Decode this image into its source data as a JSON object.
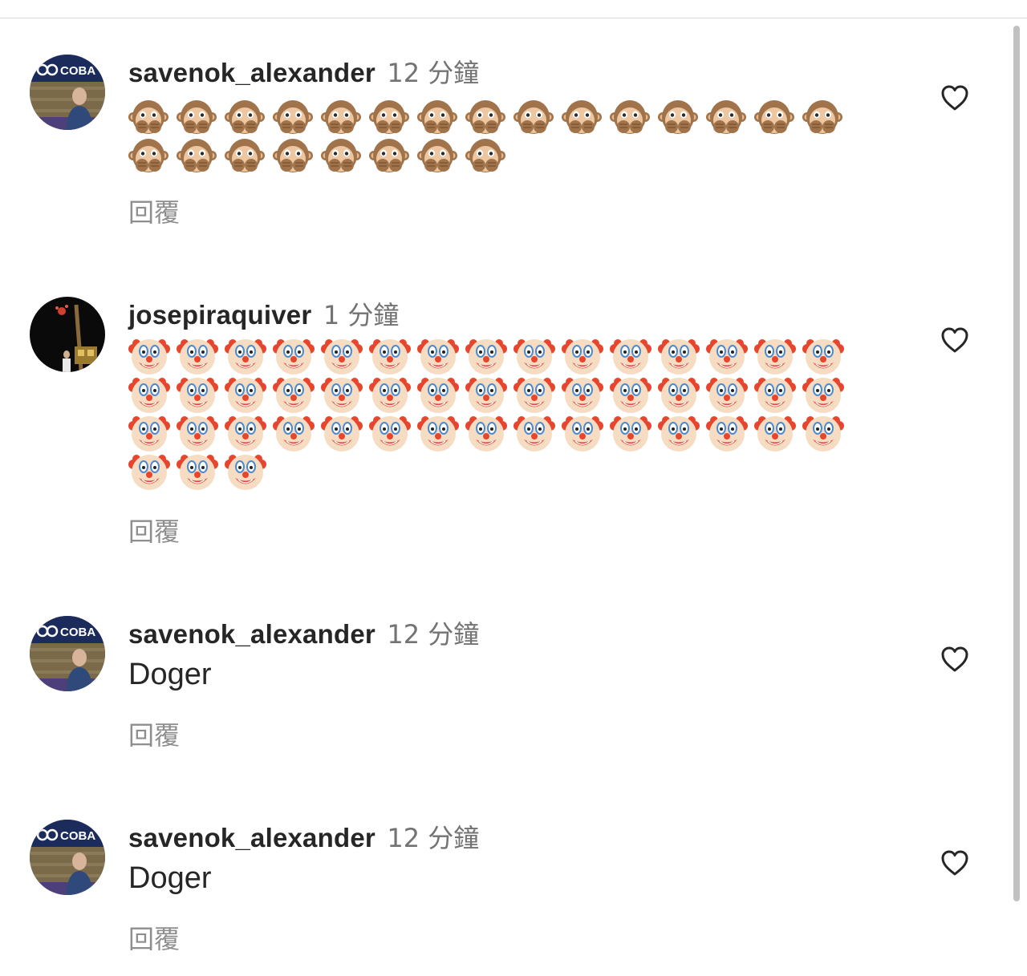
{
  "comments": [
    {
      "username": "savenok_alexander",
      "time": "12 分鐘",
      "text": "",
      "emoji": "🙊",
      "emoji_count": 23,
      "reply_label": "回覆",
      "avatar": "avatar-coba-sign"
    },
    {
      "username": "josepiraquiver",
      "time": "1 分鐘",
      "text": "",
      "emoji": "🤡",
      "emoji_count": 48,
      "reply_label": "回覆",
      "avatar": "avatar-night-fireworks"
    },
    {
      "username": "savenok_alexander",
      "time": "12 分鐘",
      "text": "Doger",
      "emoji": "",
      "emoji_count": 0,
      "reply_label": "回覆",
      "avatar": "avatar-coba-sign"
    },
    {
      "username": "savenok_alexander",
      "time": "12 分鐘",
      "text": "Doger",
      "emoji": "",
      "emoji_count": 0,
      "reply_label": "回覆",
      "avatar": "avatar-coba-sign"
    }
  ],
  "avatar_sign_text": "COBA",
  "icons": {
    "like": "heart-outline-icon",
    "monkey": "speak-no-evil-monkey-icon",
    "clown": "clown-face-icon"
  },
  "colors": {
    "text": "#262626",
    "secondary": "#737373",
    "reply": "#8e8e8e",
    "divider": "#dbdbdb",
    "scrollbar": "#c1c1c1"
  }
}
